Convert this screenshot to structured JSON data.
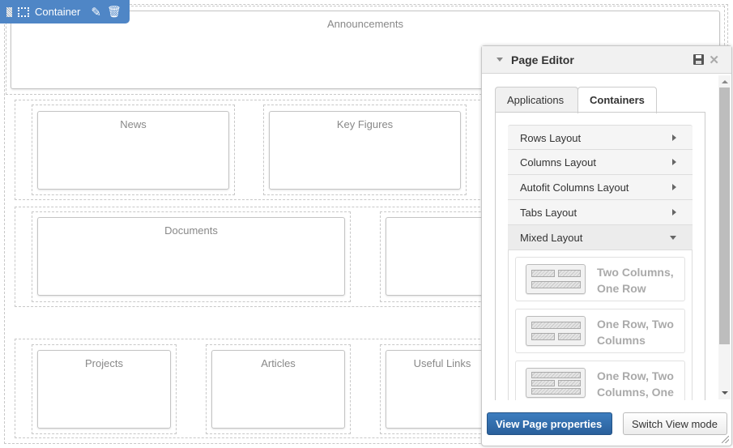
{
  "toolbar": {
    "label": "Container"
  },
  "portlets": {
    "announcements": "Announcements",
    "news": "News",
    "key_figures": "Key Figures",
    "documents": "Documents",
    "projects": "Projects",
    "articles": "Articles",
    "useful_links": "Useful Links"
  },
  "editor": {
    "title": "Page Editor",
    "tabs": [
      {
        "label": "Applications"
      },
      {
        "label": "Containers",
        "active": true
      }
    ],
    "layouts": [
      {
        "label": "Rows Layout"
      },
      {
        "label": "Columns Layout"
      },
      {
        "label": "Autofit Columns Layout"
      },
      {
        "label": "Tabs Layout"
      },
      {
        "label": "Mixed Layout",
        "expanded": true
      }
    ],
    "mixed": [
      {
        "l1": "Two Columns,",
        "l2": "One Row"
      },
      {
        "l1": "One Row, Two",
        "l2": "Columns"
      },
      {
        "l1": "One Row, Two",
        "l2": "Columns, One"
      }
    ],
    "view_props": "View Page properties",
    "switch_mode": "Switch View mode"
  },
  "colors": {
    "accent": "#4f86c6",
    "primary_button": "#2d6aa6"
  }
}
